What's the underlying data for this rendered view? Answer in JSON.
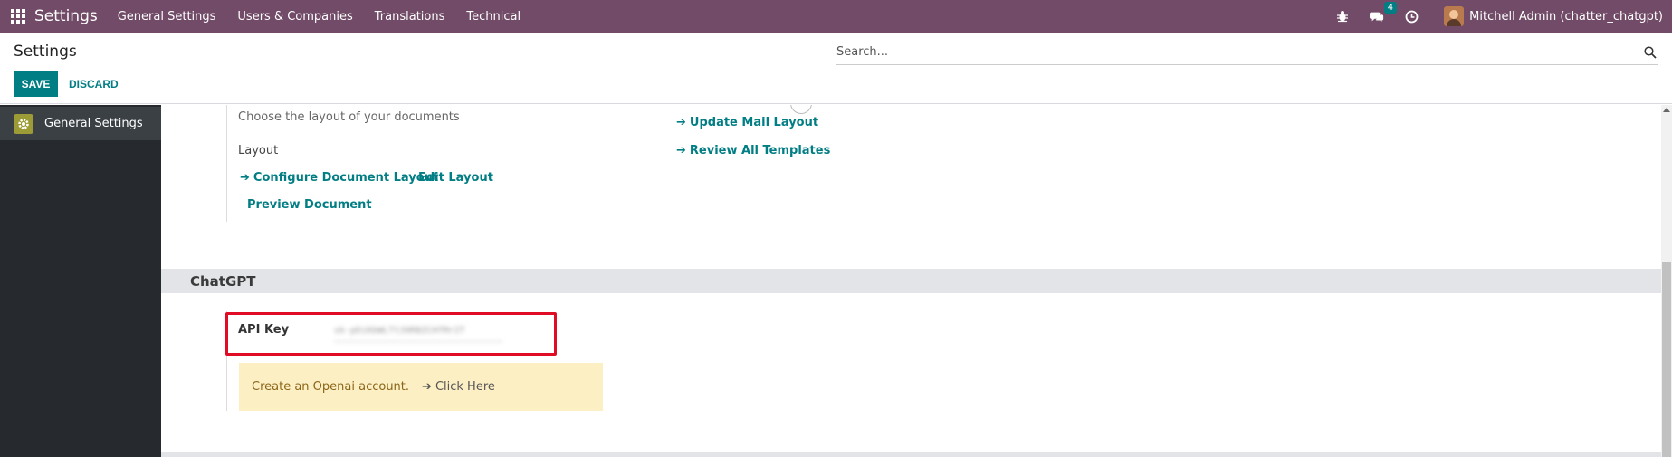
{
  "navbar": {
    "app_title": "Settings",
    "menu": [
      "General Settings",
      "Users & Companies",
      "Translations",
      "Technical"
    ],
    "messages_count": "4",
    "user_name": "Mitchell Admin (chatter_chatgpt)"
  },
  "control_panel": {
    "page_title": "Settings",
    "save_label": "SAVE",
    "discard_label": "DISCARD",
    "search_placeholder": "Search..."
  },
  "sidebar": {
    "items": [
      {
        "label": "General Settings",
        "icon": "settings-icon"
      }
    ]
  },
  "document_layout": {
    "description": "Choose the layout of your documents",
    "layout_label": "Layout",
    "configure_link": "Configure Document Layout",
    "edit_link": "Edit Layout",
    "preview_link": "Preview Document"
  },
  "mail": {
    "update_link": "Update Mail Layout",
    "review_link": "Review All Templates"
  },
  "chatgpt": {
    "section_title": "ChatGPT",
    "api_key_label": "API Key",
    "api_key_value": "sk-pDiKbWLTt39RBZCHfMr2T",
    "alert_text": "Create an Openai account.",
    "alert_link": "Click Here"
  },
  "colors": {
    "navbar": "#714b67",
    "primary": "#017e84",
    "highlight": "#e00b25",
    "alert_bg": "#fdefc4"
  }
}
